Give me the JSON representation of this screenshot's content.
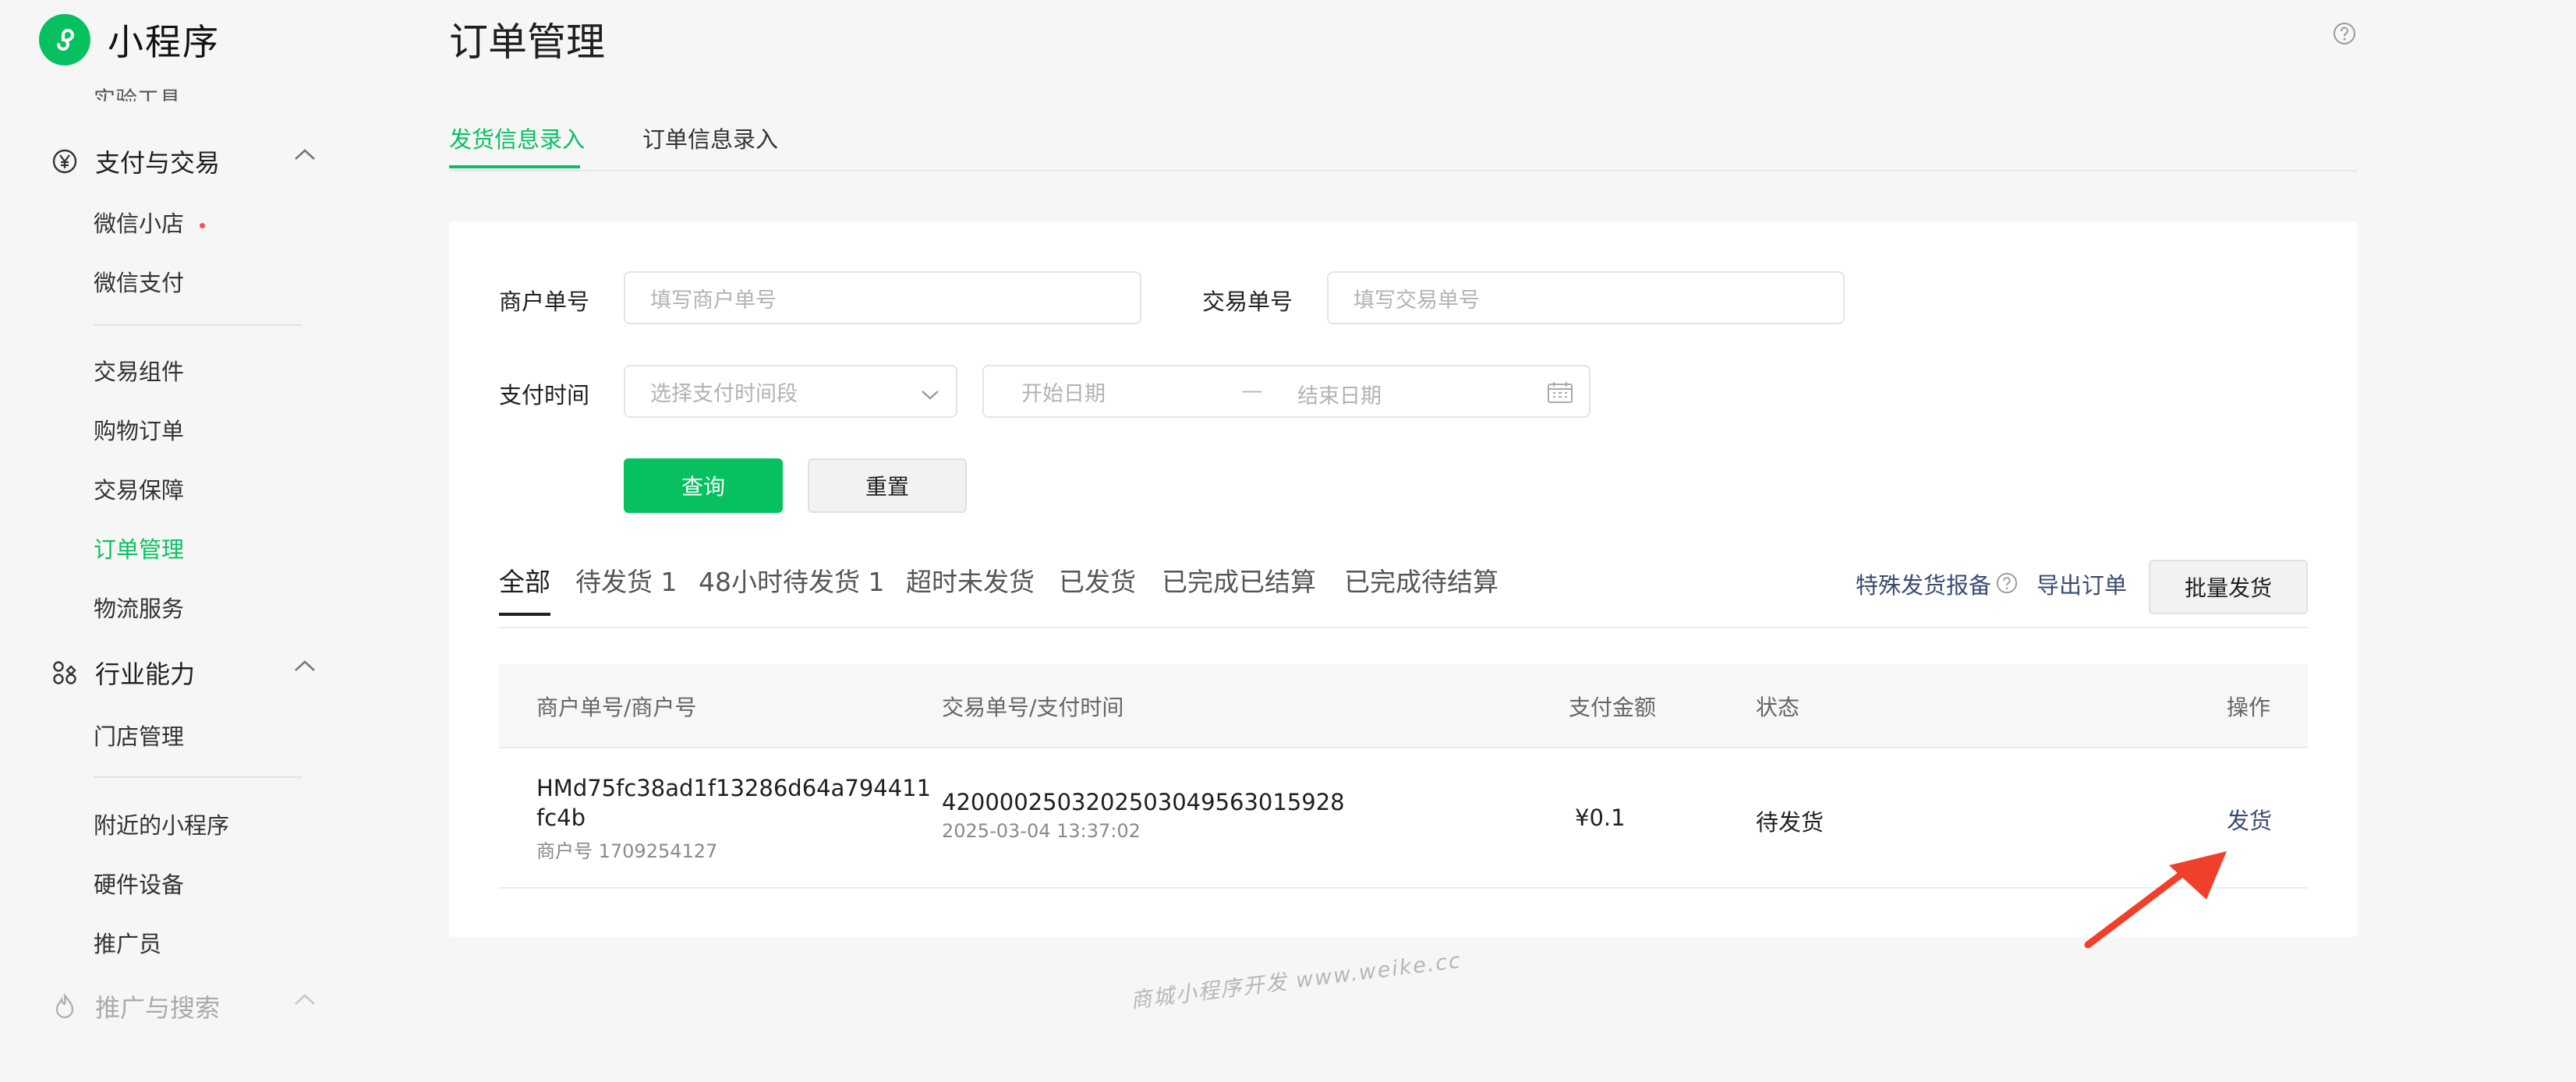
{
  "app": {
    "name": "小程序"
  },
  "sidebar": {
    "cutoff_item": "实验工具",
    "group_payment": {
      "title": "支付与交易"
    },
    "payment_items": [
      {
        "label": "微信小店"
      },
      {
        "label": "微信支付"
      }
    ],
    "trade_items": [
      {
        "label": "交易组件"
      },
      {
        "label": "购物订单"
      },
      {
        "label": "交易保障"
      },
      {
        "label": "订单管理"
      },
      {
        "label": "物流服务"
      }
    ],
    "group_industry": {
      "title": "行业能力"
    },
    "industry_items": [
      {
        "label": "门店管理"
      }
    ],
    "more_items": [
      {
        "label": "附近的小程序"
      },
      {
        "label": "硬件设备"
      },
      {
        "label": "推广员"
      }
    ],
    "group_promo": {
      "title": "推广与搜索"
    }
  },
  "page": {
    "title": "订单管理"
  },
  "tabs": [
    {
      "label": "发货信息录入"
    },
    {
      "label": "订单信息录入"
    }
  ],
  "filters": {
    "merchant_no_label": "商户单号",
    "merchant_no_placeholder": "填写商户单号",
    "trade_no_label": "交易单号",
    "trade_no_placeholder": "填写交易单号",
    "pay_time_label": "支付时间",
    "pay_time_placeholder": "选择支付时间段",
    "start_date_placeholder": "开始日期",
    "date_separator": "—",
    "end_date_placeholder": "结束日期",
    "query_button": "查询",
    "reset_button": "重置"
  },
  "status_tabs": [
    {
      "label": "全部"
    },
    {
      "label": "待发货 1"
    },
    {
      "label": "48小时待发货 1"
    },
    {
      "label": "超时未发货"
    },
    {
      "label": "已发货"
    },
    {
      "label": "已完成已结算"
    },
    {
      "label": "已完成待结算"
    }
  ],
  "actions": {
    "special_report": "特殊发货报备",
    "export_orders": "导出订单",
    "batch_ship": "批量发货"
  },
  "table": {
    "headers": {
      "merchant": "商户单号/商户号",
      "trade": "交易单号/支付时间",
      "amount": "支付金额",
      "status": "状态",
      "operation": "操作"
    },
    "rows": [
      {
        "merchant_order_line1": "HMd75fc38ad1f13286d64a794411",
        "merchant_order_line2": "fc4b",
        "merchant_id": "商户号 1709254127",
        "trade_no": "4200002503202503049563015928",
        "pay_time": "2025-03-04 13:37:02",
        "amount": "¥0.1",
        "status": "待发货",
        "action": "发货"
      }
    ]
  },
  "watermark": "商城小程序开发 www.weike.cc",
  "colors": {
    "accent": "#07c160",
    "link": "#3a4b71",
    "annotation": "#f0402c"
  }
}
